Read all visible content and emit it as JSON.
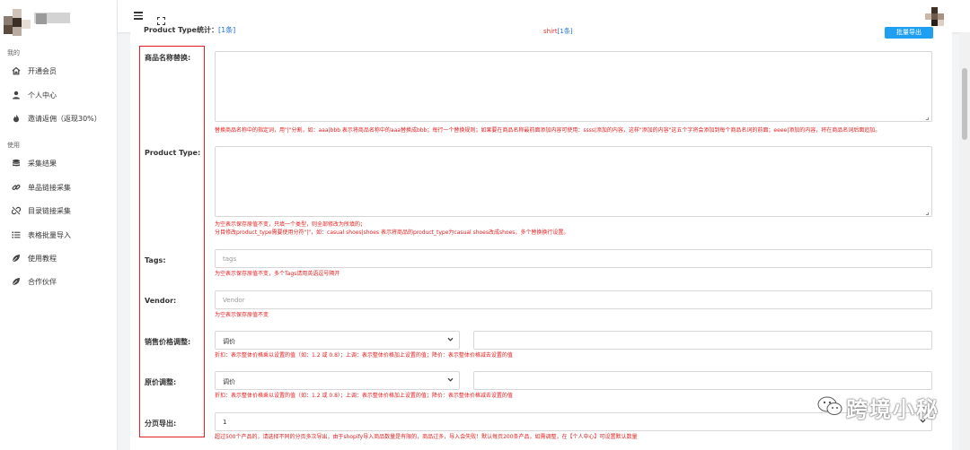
{
  "sidebar": {
    "section1": "我的",
    "section2": "使用",
    "items": [
      {
        "label": "开通会员",
        "icon": "home-icon"
      },
      {
        "label": "个人中心",
        "icon": "user-icon"
      },
      {
        "label": "邀请返佣（返现30%）",
        "icon": "fire-icon"
      },
      {
        "label": "采集结果",
        "icon": "database-icon"
      },
      {
        "label": "单品链接采集",
        "icon": "link-icon"
      },
      {
        "label": "目录链接采集",
        "icon": "unlink-icon"
      },
      {
        "label": "表格批量导入",
        "icon": "list-icon"
      },
      {
        "label": "使用教程",
        "icon": "leaf-icon"
      },
      {
        "label": "合作伙伴",
        "icon": "leaf-icon"
      }
    ]
  },
  "top_peek": {
    "label": "Product Type统计：",
    "link1": "[1条]",
    "mid": "shirt",
    "link2": "[1条]",
    "button": "批量导出"
  },
  "form": {
    "name_replace": {
      "label": "商品名称替换:",
      "hint": "替换商品名称中的指定词，用\"|\"分割，如：aaa|bbb 表示将商品名称中的aaa替换成bbb；每行一个替换规则；如果要在商品名称最前面添加内容可使用：ssss|添加的内容，这样\"添加的内容\"这五个字将会添加到每个商品名词的前面；eeee|添加的内容，将在商品名词后面追加。"
    },
    "product_type": {
      "label": "Product Type:",
      "hint1": "为空表示保存原值不变，只填一个类型，则全部修改为所填的；",
      "hint2": "分目修改product_type需要使用分符\"|\"，如：casual shoes|shoes 表示将商品的product_type为casual shoes改成shoes，多个替换换行设置。"
    },
    "tags": {
      "label": "Tags:",
      "placeholder": "tags",
      "hint": "为空表示保存原值不变，多个Tags请用英语逗号隔开"
    },
    "vendor": {
      "label": "Vendor:",
      "placeholder": "Vendor",
      "hint": "为空表示保存原值不变"
    },
    "sale_price": {
      "label": "销售价格调整:",
      "select": "调价",
      "hint": "折扣：表示整体价格乘以设置的值（如：1.2 或 0.8）；上调：表示整体价格加上设置的值；降价：表示整体价格减去设置的值"
    },
    "orig_price": {
      "label": "原价调整:",
      "select": "调价",
      "hint": "折扣：表示整体价格乘以设置的值（如：1.2 或 0.8）；上调：表示整体价格加上设置的值；降价：表示整体价格减去设置的值"
    },
    "pagination": {
      "label": "分页导出:",
      "select": "1",
      "hint": "超过500个产品的，请选择不同的分页多次导出，由于shopify导入商品数量是有限的，商品过多，导入会失败！默认每页200条产品，如需调整，在【个人中心】可设置默认数量"
    }
  },
  "watermark": "跨境小秘",
  "colors": {
    "accent": "#1e9ff2",
    "error": "#e02020",
    "link": "#1e6fd9"
  }
}
